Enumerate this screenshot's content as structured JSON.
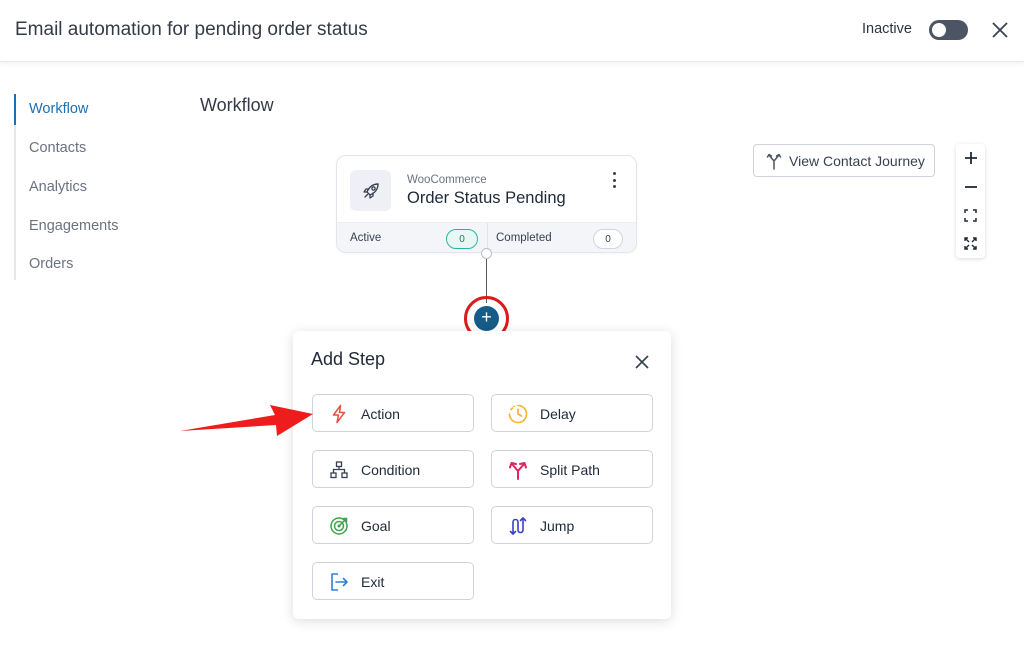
{
  "header": {
    "title": "Email automation for pending order status",
    "status_label": "Inactive",
    "toggle_on": false
  },
  "sidebar": {
    "items": [
      {
        "label": "Workflow",
        "active": true
      },
      {
        "label": "Contacts",
        "active": false
      },
      {
        "label": "Analytics",
        "active": false
      },
      {
        "label": "Engagements",
        "active": false
      },
      {
        "label": "Orders",
        "active": false
      }
    ]
  },
  "main": {
    "section_title": "Workflow",
    "journey_button": "View Contact Journey",
    "zoom_controls": [
      "plus-icon",
      "minus-icon",
      "fit-view-icon",
      "fullscreen-icon"
    ],
    "trigger": {
      "source": "WooCommerce",
      "name": "Order Status Pending",
      "active_label": "Active",
      "active_count": "0",
      "completed_label": "Completed",
      "completed_count": "0"
    },
    "add_step_button": "+"
  },
  "add_step_modal": {
    "title": "Add Step",
    "steps": [
      {
        "label": "Action",
        "icon": "lightning-icon",
        "color": "#e5533d"
      },
      {
        "label": "Delay",
        "icon": "clock-icon",
        "color": "#f2b233"
      },
      {
        "label": "Condition",
        "icon": "hierarchy-icon",
        "color": "#374151"
      },
      {
        "label": "Split Path",
        "icon": "split-arrows-icon",
        "color": "#e0245e"
      },
      {
        "label": "Goal",
        "icon": "target-icon",
        "color": "#3fa34d"
      },
      {
        "label": "Jump",
        "icon": "jump-icon",
        "color": "#3b3fc4"
      },
      {
        "label": "Exit",
        "icon": "exit-icon",
        "color": "#2f7fd6"
      }
    ]
  },
  "colors": {
    "accent": "#1f6fb0",
    "add_button": "#175b87",
    "highlight_ring": "#d91c1c",
    "pointer_arrow": "#ee1c1c"
  }
}
